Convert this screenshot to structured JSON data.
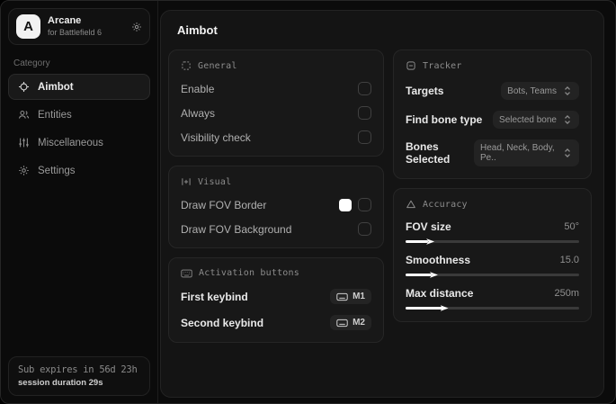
{
  "app": {
    "name": "Arcane",
    "subtitle": "for Battlefield 6",
    "logo_letter": "A",
    "page_title": "Aimbot"
  },
  "sidebar": {
    "category_label": "Category",
    "items": [
      {
        "label": "Aimbot",
        "icon": "crosshair-icon",
        "active": true
      },
      {
        "label": "Entities",
        "icon": "entities-icon",
        "active": false
      },
      {
        "label": "Miscellaneous",
        "icon": "misc-sliders-icon",
        "active": false
      },
      {
        "label": "Settings",
        "icon": "gear-icon",
        "active": false
      }
    ],
    "status": {
      "sub_expires": "Sub expires in 56d 23h",
      "session_duration": "session duration 29s"
    }
  },
  "cards": {
    "general": {
      "title": "General",
      "rows": [
        {
          "label": "Enable",
          "checked": false
        },
        {
          "label": "Always",
          "checked": false
        },
        {
          "label": "Visibility check",
          "checked": false
        }
      ]
    },
    "visual": {
      "title": "Visual",
      "rows": [
        {
          "label": "Draw FOV Border",
          "swatch_color": "#ffffff",
          "checked": false
        },
        {
          "label": "Draw FOV Background",
          "checked": false
        }
      ]
    },
    "activation": {
      "title": "Activation buttons",
      "rows": [
        {
          "label": "First keybind",
          "key": "M1"
        },
        {
          "label": "Second keybind",
          "key": "M2"
        }
      ]
    },
    "tracker": {
      "title": "Tracker",
      "rows": [
        {
          "label": "Targets",
          "value": "Bots, Teams"
        },
        {
          "label": "Find bone type",
          "value": "Selected bone"
        },
        {
          "label": "Bones Selected",
          "value": "Head, Neck, Body, Pe.."
        }
      ]
    },
    "accuracy": {
      "title": "Accuracy",
      "rows": [
        {
          "label": "FOV size",
          "value": "50°",
          "percent": 13
        },
        {
          "label": "Smoothness",
          "value": "15.0",
          "percent": 15
        },
        {
          "label": "Max distance",
          "value": "250m",
          "percent": 21
        }
      ]
    }
  },
  "colors": {
    "accent": "#ffffff",
    "slider_track": "#3a3a3a",
    "card_bg": "#181818",
    "panel_bg": "#141414",
    "sidebar_bg": "#0b0b0b"
  }
}
